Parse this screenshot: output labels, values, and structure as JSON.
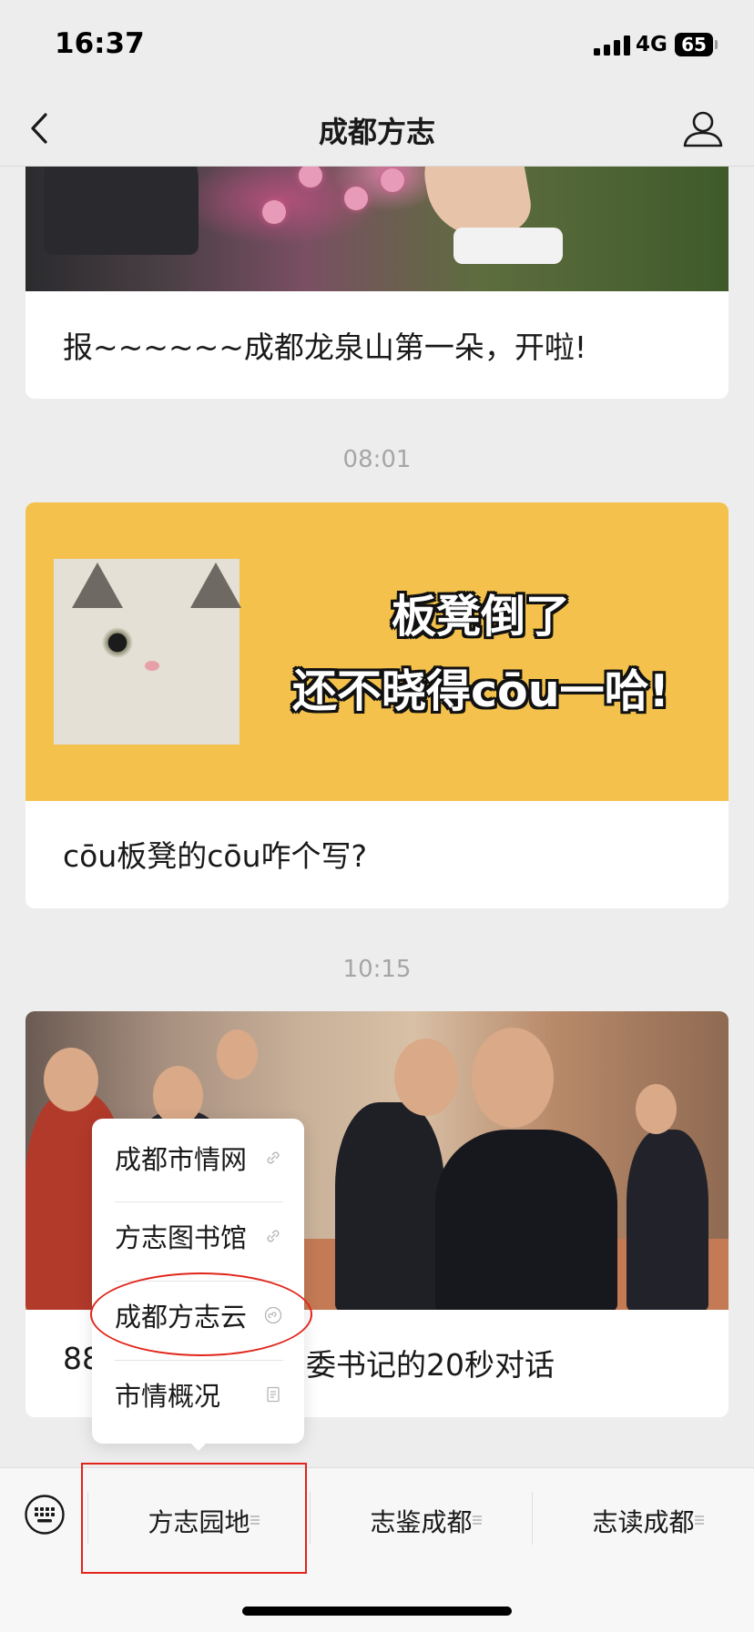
{
  "status": {
    "time": "16:37",
    "network": "4G",
    "battery": "65"
  },
  "nav": {
    "title": "成都方志"
  },
  "feed": {
    "items": [
      {
        "title": "报~~~~~~成都龙泉山第一朵，开啦!"
      },
      {
        "timestamp": "08:01",
        "banner_line1": "板凳倒了",
        "banner_line2": "还不晓得cōu一哈!",
        "title": "cōu板凳的cōu咋个写?"
      },
      {
        "timestamp": "10:15",
        "title_left": "88",
        "title_right": "委书记的20秒对话"
      }
    ]
  },
  "popup": {
    "items": [
      {
        "label": "成都市情网",
        "icon": "link-icon"
      },
      {
        "label": "方志图书馆",
        "icon": "link-icon"
      },
      {
        "label": "成都方志云",
        "icon": "mini-program-icon"
      },
      {
        "label": "市情概况",
        "icon": "article-icon"
      }
    ]
  },
  "menu_bar": {
    "tabs": [
      {
        "label": "方志园地"
      },
      {
        "label": "志鉴成都"
      },
      {
        "label": "志读成都"
      }
    ]
  },
  "annotation_color": "#e1251b"
}
